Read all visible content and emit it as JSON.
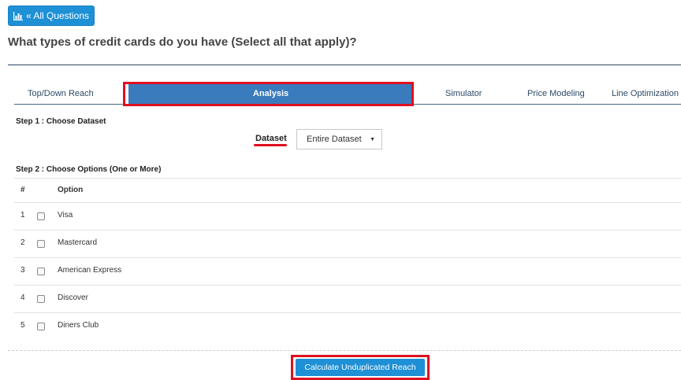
{
  "toolbar": {
    "all_questions_label": "« All Questions"
  },
  "question": {
    "title": "What types of credit cards do you have (Select all that apply)?"
  },
  "tabs": [
    {
      "label": "Top/Down Reach"
    },
    {
      "label": "Analysis"
    },
    {
      "label": "Simulator"
    },
    {
      "label": "Price Modeling"
    },
    {
      "label": "Line Optimization"
    }
  ],
  "steps": {
    "step1": "Step 1 : Choose Dataset",
    "step2": "Step 2 : Choose Options (One or More)"
  },
  "dataset": {
    "label": "Dataset",
    "selected": "Entire Dataset"
  },
  "table": {
    "headers": {
      "num": "#",
      "option": "Option"
    },
    "rows": [
      {
        "num": "1",
        "option": "Visa"
      },
      {
        "num": "2",
        "option": "Mastercard"
      },
      {
        "num": "3",
        "option": "American Express"
      },
      {
        "num": "4",
        "option": "Discover"
      },
      {
        "num": "5",
        "option": "Diners Club"
      }
    ]
  },
  "actions": {
    "calculate_label": "Calculate Unduplicated Reach"
  },
  "colors": {
    "accent": "#1e90d6",
    "tab_active": "#3a7bbd",
    "highlight": "#e01020"
  }
}
